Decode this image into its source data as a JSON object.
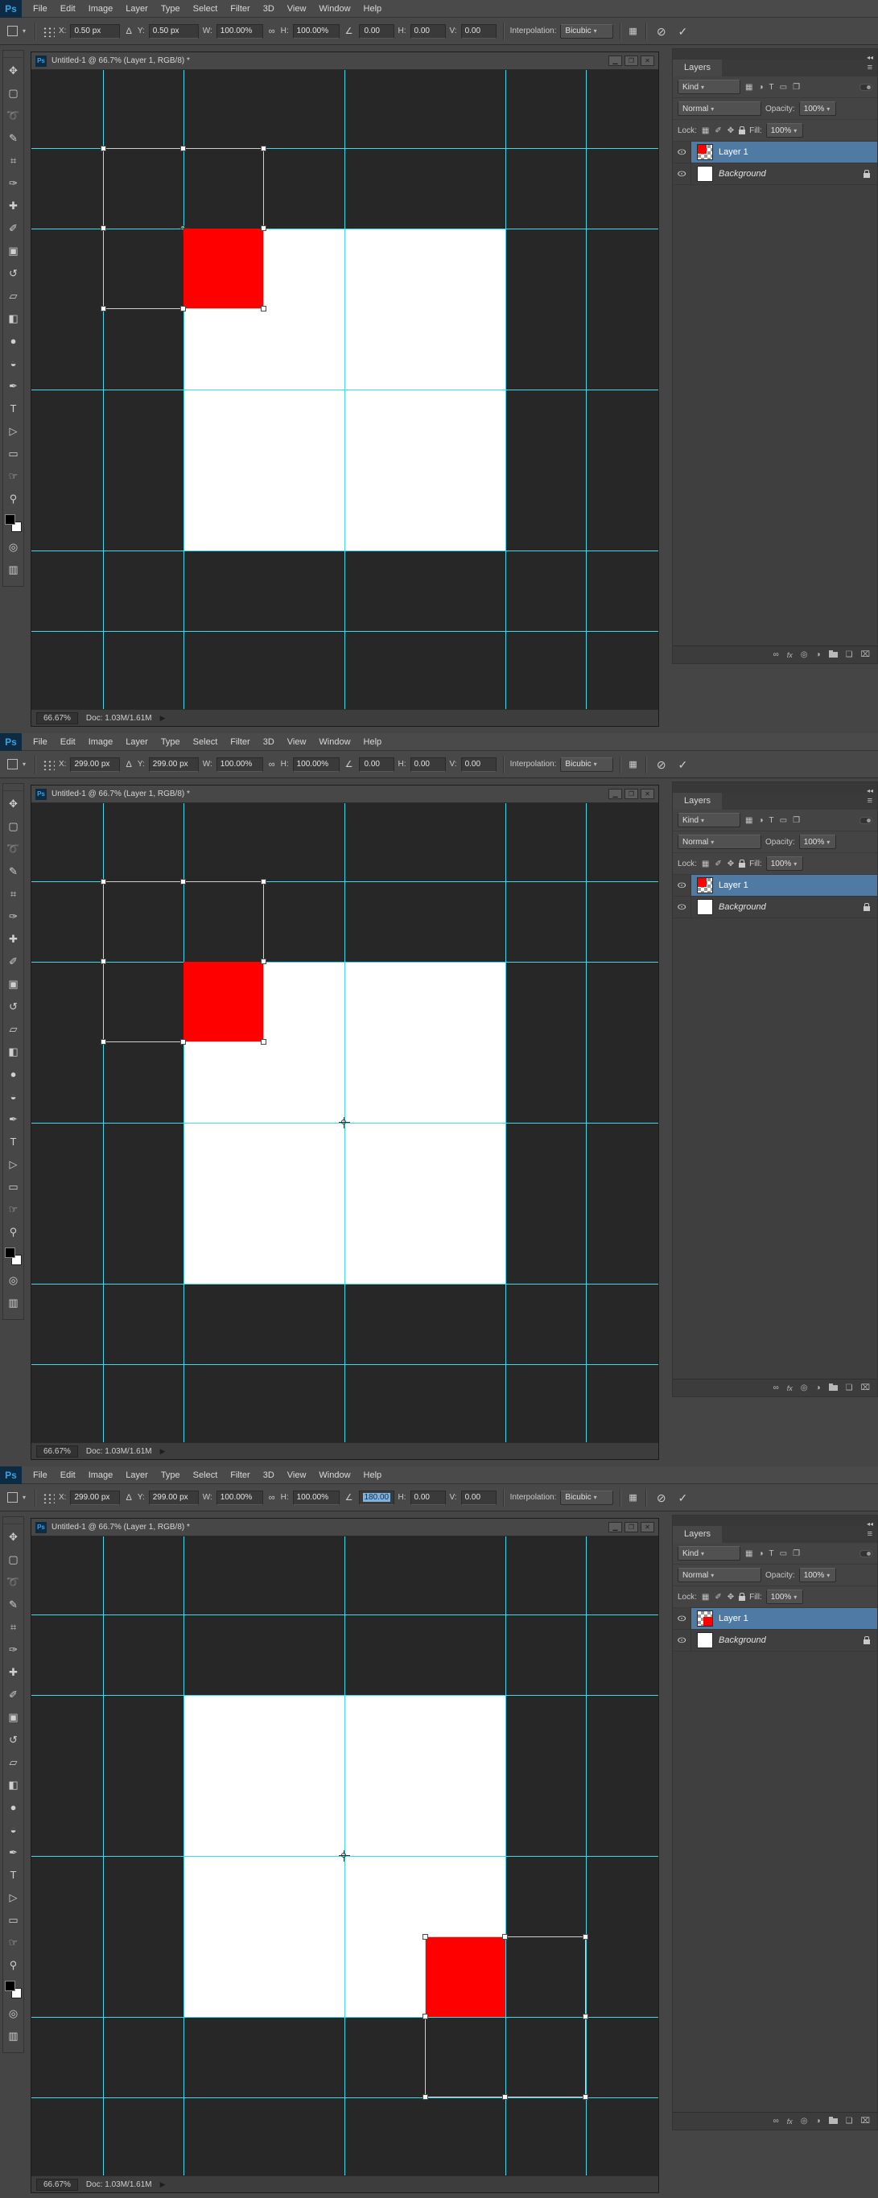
{
  "app": {
    "logo": "Ps",
    "menu": [
      "File",
      "Edit",
      "Image",
      "Layer",
      "Type",
      "Select",
      "Filter",
      "3D",
      "View",
      "Window",
      "Help"
    ],
    "tools": [
      {
        "name": "move",
        "glyph": "✥"
      },
      {
        "name": "rectangular-marquee",
        "glyph": "▢"
      },
      {
        "name": "lasso",
        "glyph": "➰"
      },
      {
        "name": "quick-selection",
        "glyph": "✎"
      },
      {
        "name": "crop",
        "glyph": "⌗"
      },
      {
        "name": "eyedropper",
        "glyph": "✑"
      },
      {
        "name": "healing-brush",
        "glyph": "✚"
      },
      {
        "name": "brush",
        "glyph": "✐"
      },
      {
        "name": "clone-stamp",
        "glyph": "▣"
      },
      {
        "name": "history-brush",
        "glyph": "↺"
      },
      {
        "name": "eraser",
        "glyph": "▱"
      },
      {
        "name": "gradient",
        "glyph": "◧"
      },
      {
        "name": "blur",
        "glyph": "●"
      },
      {
        "name": "dodge",
        "glyph": "◒"
      },
      {
        "name": "pen",
        "glyph": "✒"
      },
      {
        "name": "type",
        "glyph": "T"
      },
      {
        "name": "path-selection",
        "glyph": "▷"
      },
      {
        "name": "rectangle-shape",
        "glyph": "▭"
      },
      {
        "name": "hand",
        "glyph": "☞"
      },
      {
        "name": "zoom",
        "glyph": "⚲"
      },
      {
        "name": "quick-mask",
        "glyph": "◎"
      },
      {
        "name": "screen-mode",
        "glyph": "▥"
      }
    ]
  },
  "icons": {
    "dropdown": "▾",
    "delta": "Δ",
    "angle": "∠",
    "link": "∞",
    "warp": "▦",
    "cancel": "⊘",
    "commit": "✓",
    "collapse": "◂◂",
    "menu": "≡",
    "eye": "⊙",
    "minimize": "▁",
    "restore": "❐",
    "close": "✕",
    "play": "▶",
    "f_pixel": "▦",
    "f_adjust": "◑",
    "f_type": "T",
    "f_shape": "▭",
    "f_smart": "❐",
    "lock_transparency": "▦",
    "lock_paint": "✐",
    "lock_position": "✥",
    "b_link": "∞",
    "b_fx": "fx",
    "b_mask": "◎",
    "b_adjust": "◑",
    "b_new_layer": "❏",
    "b_delete": "⌧"
  },
  "options": {
    "x_label": "X:",
    "y_label": "Y:",
    "w_label": "W:",
    "h_label": "H:",
    "v_label": "V:",
    "w_value": "100.00%",
    "h_value": "100.00%",
    "skew_h": "0.00",
    "skew_v": "0.00",
    "interp_label": "Interpolation:",
    "interp_value": "Bicubic"
  },
  "doc": {
    "title": "Untitled-1 @ 66.7% (Layer 1, RGB/8) *",
    "zoom": "66.67%",
    "size": "Doc: 1.03M/1.61M"
  },
  "layers": {
    "tab": "Layers",
    "kind": "Kind",
    "blend": "Normal",
    "opacity_label": "Opacity:",
    "opacity": "100%",
    "lock_label": "Lock:",
    "fill_label": "Fill:",
    "fill": "100%",
    "layer1": "Layer 1",
    "background": "Background"
  },
  "panels": [
    {
      "x": "0.50 px",
      "y": "0.50 px",
      "rotation": "0.00"
    },
    {
      "x": "299.00 px",
      "y": "299.00 px",
      "rotation": "0.00"
    },
    {
      "x": "299.00 px",
      "y": "299.00 px",
      "rotation": "180.00"
    }
  ],
  "colors": {
    "guide": "#3fd9ea",
    "red_square": "#fe0000",
    "logo_accent": "#35a3ea",
    "selected_layer": "#4f7aa3"
  }
}
